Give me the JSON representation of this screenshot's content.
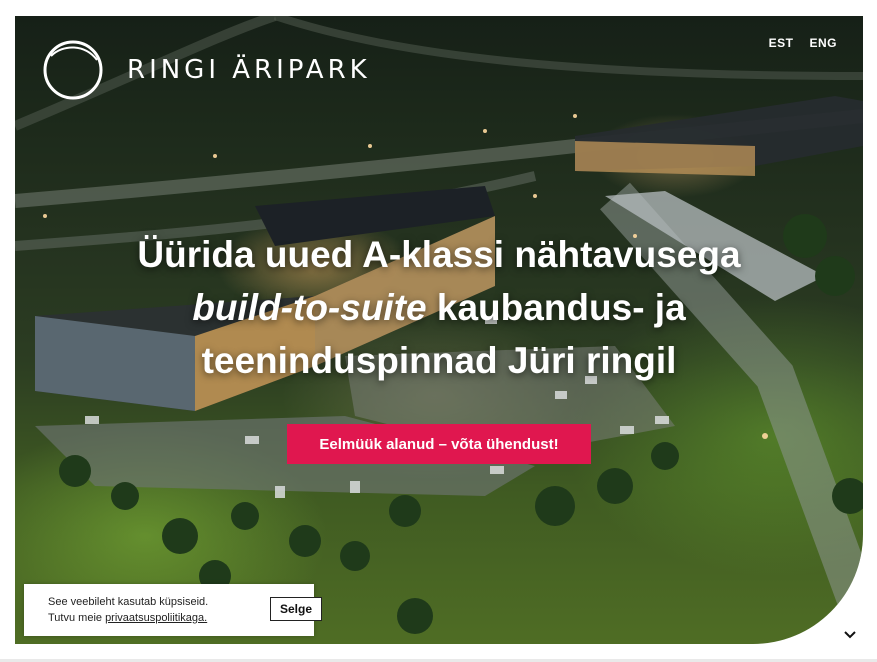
{
  "brand": {
    "name": "RINGI ÄRIPARK"
  },
  "language_switch": {
    "items": [
      "EST",
      "ENG"
    ]
  },
  "hero": {
    "headline_line1": "Üürida uued A-klassi nähtavusega",
    "headline_line2_italic": "build-to-suite",
    "headline_line2_rest": " kaubandus- ja",
    "headline_line3": "teeninduspinnad Jüri ringil",
    "cta_label": "Eelmüük alanud – võta ühendust!"
  },
  "cookie_notice": {
    "line1": "See veebileht kasutab küpsiseid.",
    "line2_prefix": "Tutvu meie ",
    "link_text": "privaatsuspoliitikaga.",
    "accept_label": "Selge"
  },
  "colors": {
    "accent": "#e0174f",
    "text_on_hero": "#ffffff"
  },
  "icons": {
    "logo": "ring-logo-icon",
    "scroll": "chevron-down-icon"
  }
}
